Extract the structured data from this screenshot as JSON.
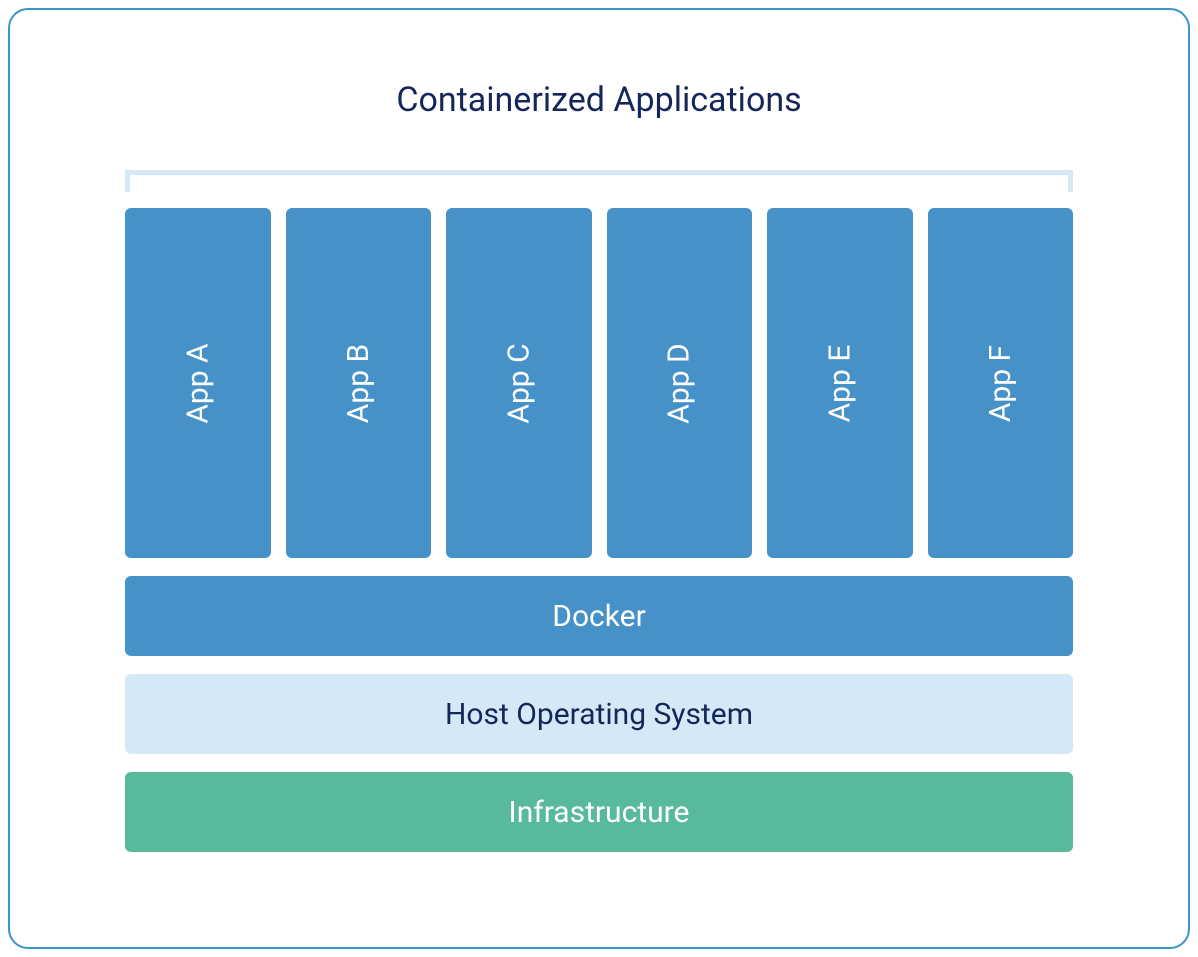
{
  "title": "Containerized Applications",
  "apps": [
    {
      "label": "App A"
    },
    {
      "label": "App B"
    },
    {
      "label": "App C"
    },
    {
      "label": "App D"
    },
    {
      "label": "App E"
    },
    {
      "label": "App F"
    }
  ],
  "layers": {
    "docker": "Docker",
    "os": "Host Operating System",
    "infra": "Infrastructure"
  },
  "colors": {
    "app_bg": "#4692c8",
    "os_bg": "#d5e8f5",
    "infra_bg": "#59b99d",
    "border": "#3b95cc",
    "title_text": "#14265a"
  }
}
